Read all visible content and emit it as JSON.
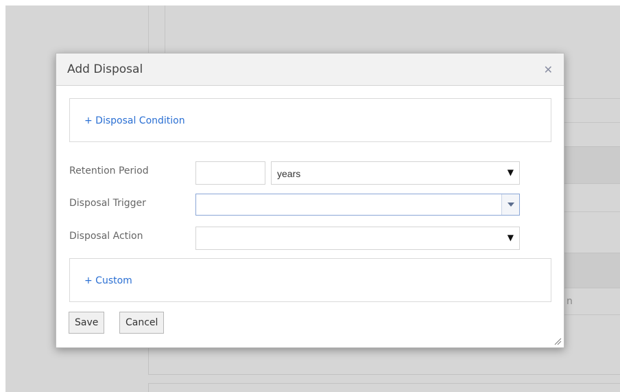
{
  "modal": {
    "title": "Add Disposal",
    "close_icon": "close-icon",
    "disposal_condition_link": "+ Disposal Condition",
    "custom_link": "+ Custom"
  },
  "form": {
    "retention_period": {
      "label": "Retention Period",
      "value": "",
      "unit_selected": "years"
    },
    "disposal_trigger": {
      "label": "Disposal Trigger",
      "value": ""
    },
    "disposal_action": {
      "label": "Disposal Action",
      "value": ""
    }
  },
  "buttons": {
    "save": "Save",
    "cancel": "Cancel"
  },
  "background": {
    "partial_text": "n"
  },
  "colors": {
    "link": "#2a6fd3",
    "combo_focus_border": "#8aa6d6",
    "header_bg": "#f2f2f2",
    "overlay_bg": "#d6d6d6"
  }
}
